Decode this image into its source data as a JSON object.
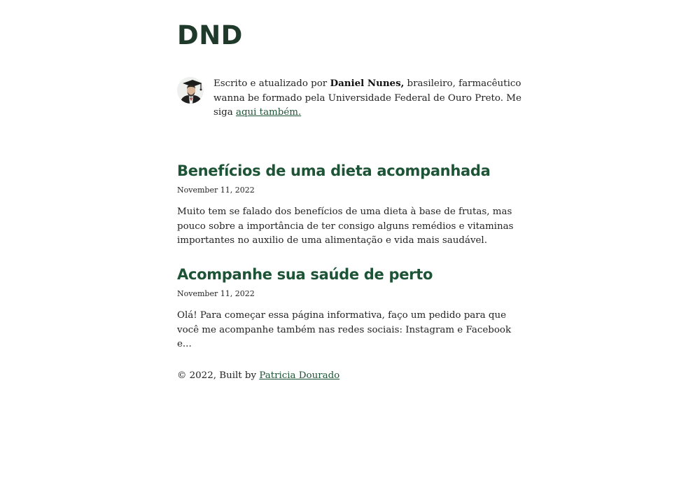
{
  "site": {
    "title": "DND"
  },
  "bio": {
    "prefix": "Escrito e atualizado por ",
    "author": "Daniel Nunes,",
    "suffix": " brasileiro, farmacêutico wanna be formado pela Universidade Federal de Ouro Preto. Me siga ",
    "link_label": "aqui também."
  },
  "posts": [
    {
      "title": "Benefícios de uma dieta acompanhada",
      "date": "November 11, 2022",
      "excerpt": "Muito tem se falado dos benefícios de uma dieta à base de frutas, mas pouco sobre a importância de ter consigo alguns remédios e vitaminas importantes no auxilio de uma alimentação e vida mais saudável."
    },
    {
      "title": "Acompanhe sua saúde de perto",
      "date": "November 11, 2022",
      "excerpt": "Olá! Para começar essa página informativa, faço um pedido para que você me acompanhe também nas redes sociais: Instagram e Facebook e..."
    }
  ],
  "footer": {
    "prefix": "© 2022, Built by ",
    "link_label": "Patricia Dourado"
  },
  "colors": {
    "title": "#1f3a2b",
    "link": "#1e5436",
    "text": "#222222"
  },
  "icons": {
    "avatar": "graduate-portrait-icon"
  }
}
